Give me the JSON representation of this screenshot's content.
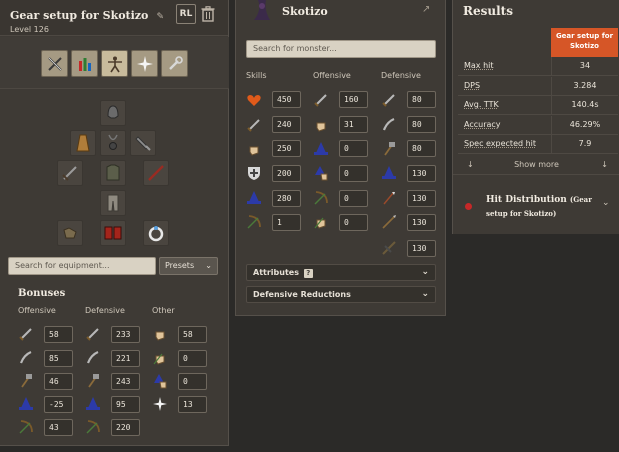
{
  "left": {
    "title": "Gear setup for Skotizo",
    "level": "Level 126",
    "rl_button": "RL",
    "equipment_search_placeholder": "Search for equipment...",
    "presets_label": "Presets",
    "bonuses_title": "Bonuses",
    "col_offensive": "Offensive",
    "col_defensive": "Defensive",
    "col_other": "Other",
    "offensive": [
      "58",
      "85",
      "46",
      "-25",
      "43"
    ],
    "defensive": [
      "233",
      "221",
      "243",
      "95",
      "220"
    ],
    "other": [
      "58",
      "0",
      "0",
      "13"
    ]
  },
  "mid": {
    "title": "Skotizo",
    "search_placeholder": "Search for monster...",
    "col_skills": "Skills",
    "col_offensive": "Offensive",
    "col_defensive": "Defensive",
    "skills": [
      "450",
      "240",
      "250",
      "200",
      "280",
      "1"
    ],
    "offensive": [
      "160",
      "31",
      "0",
      "0",
      "0",
      "0"
    ],
    "defensive": [
      "80",
      "80",
      "80",
      "130",
      "130",
      "130",
      "130"
    ],
    "attributes_label": "Attributes",
    "attributes_help": "?",
    "defensive_reductions_label": "Defensive Reductions"
  },
  "right": {
    "title": "Results",
    "setup_header": "Gear setup for Skotizo",
    "rows": [
      {
        "label": "Max hit",
        "value": "34"
      },
      {
        "label": "DPS",
        "value": "3.284"
      },
      {
        "label": "Avg. TTK",
        "value": "140.4s"
      },
      {
        "label": "Accuracy",
        "value": "46.29%"
      },
      {
        "label": "Spec expected hit",
        "value": "7.9"
      }
    ],
    "show_more": "Show more",
    "hit_dist_title": "Hit Distribution",
    "hit_dist_sub": "(Gear setup for Skotizo)"
  },
  "colors": {
    "accent": "#d65627",
    "panel": "#3e3a35",
    "background": "#2b2a28"
  }
}
